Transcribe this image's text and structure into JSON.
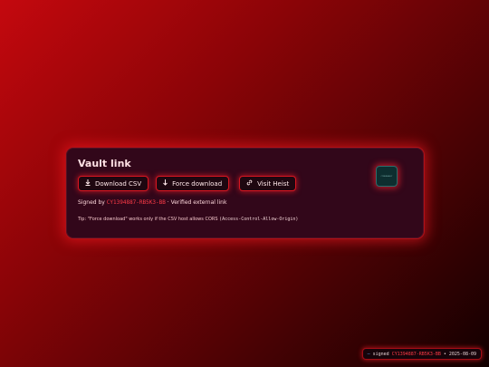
{
  "card": {
    "title": "Vault link",
    "buttons": {
      "download_csv": "Download CSV",
      "force_download": "Force download",
      "visit_heist": "Visit Heist"
    },
    "meta": {
      "signed_prefix": "Signed by",
      "signature": "CY1394887-RB5K3-BB",
      "separator": "·",
      "verified": "Verified external link"
    },
    "tip": {
      "text": "Tip: \"Force download\" works only if the CSV host allows CORS",
      "code": "(Access-Control-Allow-Origin)"
    },
    "thumbnail_label": "CYBERVAULT"
  },
  "footer": {
    "dash": "—",
    "signed_label": "signed",
    "signature": "CY1394887-RB5K3-BB",
    "bullet": "•",
    "date": "2025-08-09"
  },
  "colors": {
    "accent": "#ff3b47",
    "card_bg": "#32071a",
    "border": "#d81520"
  },
  "icons": {
    "download_csv": "download-icon",
    "force_download": "arrow-down-icon",
    "visit_heist": "link-icon"
  }
}
